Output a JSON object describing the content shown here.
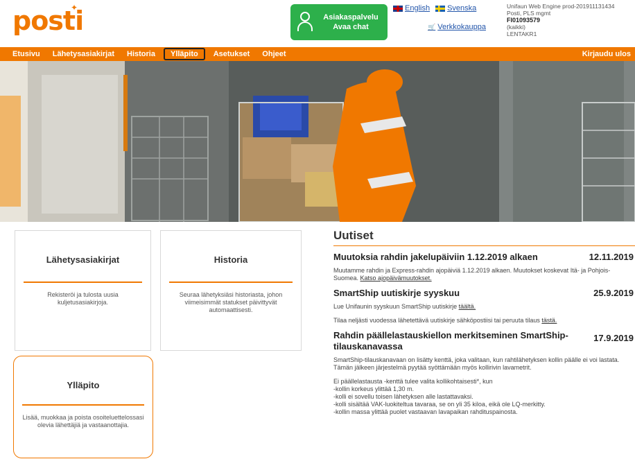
{
  "header": {
    "logo_text": "posti",
    "chat_line1": "Asiakaspalvelu",
    "chat_line2": "Avaa chat",
    "lang_english": "English",
    "lang_swedish": "Svenska",
    "webshop_link": "Verkkokauppa",
    "sysinfo": {
      "line1": "Unifaun Web Engine prod-201911131434",
      "line2": "Posti, PLS mgmt",
      "line3": "FI01093579",
      "line4": "(kaikki)",
      "line5": "LENTAKR1"
    }
  },
  "nav": {
    "items": [
      "Etusivu",
      "Lähetysasiakirjat",
      "Historia",
      "Ylläpito",
      "Asetukset",
      "Ohjeet"
    ],
    "active_index": 3,
    "login": "Kirjaudu ulos"
  },
  "cards": [
    {
      "title": "Lähetysasiakirjat",
      "desc": "Rekisteröi ja tulosta uusia kuljetusasiakirjoja."
    },
    {
      "title": "Historia",
      "desc": "Seuraa lähetyksiäsi historiasta, johon viimeisimmät statukset päivittyvät automaattisesti."
    },
    {
      "title": "Ylläpito",
      "desc": "Lisää, muokkaa ja poista osoiteluettelossasi olevia lähettäjiä ja vastaanottajia."
    }
  ],
  "news": {
    "heading": "Uutiset",
    "items": [
      {
        "title": "Muutoksia rahdin jakelupäiviin 1.12.2019 alkaen",
        "date": "12.11.2019",
        "p1": "Muutamme rahdin ja Express-rahdin ajopäiviä 1.12.2019 alkaen. Muutokset koskevat Itä- ja Pohjois-Suomea.",
        "link1": "Katso ajopäivämuutokset."
      },
      {
        "title": "SmartShip uutiskirje syyskuu",
        "date": "25.9.2019",
        "p1": "Lue Unifaunin syyskuun SmartShip uutiskirje",
        "link1": "täältä.",
        "p2": "Tilaa neljästi vuodessa lähetettävä uutiskirje sähköpostiisi tai peruuta tilaus",
        "link2": "tästä."
      },
      {
        "title": "Rahdin päällelastauskiellon merkitseminen SmartShip-tilauskanavassa",
        "date": "17.9.2019",
        "p1": "SmartShip-tilauskanavaan on lisätty kenttä, joka valitaan, kun rahtilähetyksen kollin päälle ei voi lastata. Tämän jälkeen järjestelmä pyytää syöttämään myös kollirivin lavametrit.",
        "p2": "Ei päällelastausta -kenttä tulee valita kollikohtaisesti*, kun",
        "l1": "-kollin korkeus ylittää 1,30 m.",
        "l2": "-kolli ei sovellu toisen lähetyksen alle lastattavaksi.",
        "l3": "-kolli sisältää VAK-luokiteltua tavaraa, se on yli 35 kiloa, eikä ole LQ-merkitty.",
        "l4": "-kollin massa ylittää puolet vastaavan lavapaikan rahdituspainosta."
      }
    ]
  },
  "colors": {
    "brand": "#f07800",
    "chat": "#2db04b"
  }
}
